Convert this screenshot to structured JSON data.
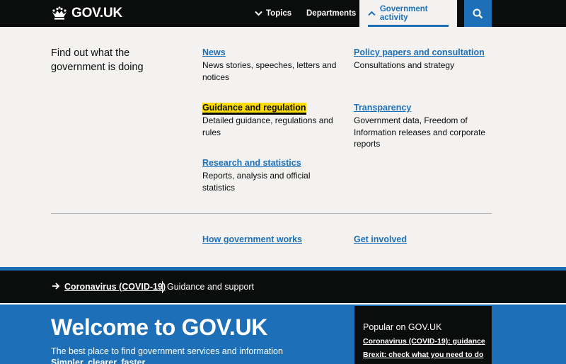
{
  "header": {
    "logo_text": "GOV.UK",
    "nav": {
      "topics": "Topics",
      "departments": "Departments",
      "government_activity": "Government activity"
    }
  },
  "menu": {
    "intro": "Find out what the government is doing",
    "links": [
      {
        "title": "News",
        "desc": "News stories, speeches, letters and notices"
      },
      {
        "title": "Policy papers and consultation",
        "desc": "Consultations and strategy"
      },
      {
        "title": "Guidance and regulation",
        "desc": "Detailed guidance, regulations and rules"
      },
      {
        "title": "Transparency",
        "desc": "Government data, Freedom of Information releases and corporate reports"
      },
      {
        "title": "Research and statistics",
        "desc": "Reports, analysis and official statistics"
      }
    ],
    "secondary": {
      "how_government_works": "How government works",
      "get_involved": "Get involved"
    }
  },
  "banner": {
    "link": "Coronavirus (COVID-19)",
    "text": "Guidance and support"
  },
  "hero": {
    "title": "Welcome to GOV.UK",
    "subtitle": "The best place to find government services and information",
    "tagline": "Simpler, clearer, faster"
  },
  "popular": {
    "heading": "Popular on GOV.UK",
    "links": [
      "Coronavirus (COVID-19): guidance",
      "Brexit: check what you need to do"
    ]
  },
  "colors": {
    "brand_blue": "#1d70b8",
    "black": "#0b0c0c",
    "focus_yellow": "#ffdd00",
    "panel_grey": "#f3f2f1"
  },
  "icons": {
    "logo": "crown-icon",
    "topics": "chevron-down-icon",
    "activity": "chevron-up-icon",
    "search": "search-icon",
    "banner": "arrow-right-icon"
  }
}
